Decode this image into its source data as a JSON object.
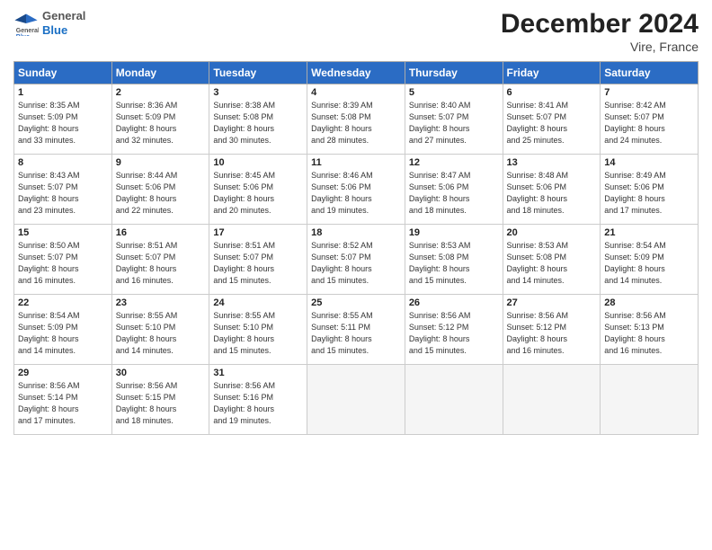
{
  "header": {
    "logo_general": "General",
    "logo_blue": "Blue",
    "month_title": "December 2024",
    "location": "Vire, France"
  },
  "weekdays": [
    "Sunday",
    "Monday",
    "Tuesday",
    "Wednesday",
    "Thursday",
    "Friday",
    "Saturday"
  ],
  "weeks": [
    [
      {
        "day": "1",
        "info": "Sunrise: 8:35 AM\nSunset: 5:09 PM\nDaylight: 8 hours\nand 33 minutes."
      },
      {
        "day": "2",
        "info": "Sunrise: 8:36 AM\nSunset: 5:09 PM\nDaylight: 8 hours\nand 32 minutes."
      },
      {
        "day": "3",
        "info": "Sunrise: 8:38 AM\nSunset: 5:08 PM\nDaylight: 8 hours\nand 30 minutes."
      },
      {
        "day": "4",
        "info": "Sunrise: 8:39 AM\nSunset: 5:08 PM\nDaylight: 8 hours\nand 28 minutes."
      },
      {
        "day": "5",
        "info": "Sunrise: 8:40 AM\nSunset: 5:07 PM\nDaylight: 8 hours\nand 27 minutes."
      },
      {
        "day": "6",
        "info": "Sunrise: 8:41 AM\nSunset: 5:07 PM\nDaylight: 8 hours\nand 25 minutes."
      },
      {
        "day": "7",
        "info": "Sunrise: 8:42 AM\nSunset: 5:07 PM\nDaylight: 8 hours\nand 24 minutes."
      }
    ],
    [
      {
        "day": "8",
        "info": "Sunrise: 8:43 AM\nSunset: 5:07 PM\nDaylight: 8 hours\nand 23 minutes."
      },
      {
        "day": "9",
        "info": "Sunrise: 8:44 AM\nSunset: 5:06 PM\nDaylight: 8 hours\nand 22 minutes."
      },
      {
        "day": "10",
        "info": "Sunrise: 8:45 AM\nSunset: 5:06 PM\nDaylight: 8 hours\nand 20 minutes."
      },
      {
        "day": "11",
        "info": "Sunrise: 8:46 AM\nSunset: 5:06 PM\nDaylight: 8 hours\nand 19 minutes."
      },
      {
        "day": "12",
        "info": "Sunrise: 8:47 AM\nSunset: 5:06 PM\nDaylight: 8 hours\nand 18 minutes."
      },
      {
        "day": "13",
        "info": "Sunrise: 8:48 AM\nSunset: 5:06 PM\nDaylight: 8 hours\nand 18 minutes."
      },
      {
        "day": "14",
        "info": "Sunrise: 8:49 AM\nSunset: 5:06 PM\nDaylight: 8 hours\nand 17 minutes."
      }
    ],
    [
      {
        "day": "15",
        "info": "Sunrise: 8:50 AM\nSunset: 5:07 PM\nDaylight: 8 hours\nand 16 minutes."
      },
      {
        "day": "16",
        "info": "Sunrise: 8:51 AM\nSunset: 5:07 PM\nDaylight: 8 hours\nand 16 minutes."
      },
      {
        "day": "17",
        "info": "Sunrise: 8:51 AM\nSunset: 5:07 PM\nDaylight: 8 hours\nand 15 minutes."
      },
      {
        "day": "18",
        "info": "Sunrise: 8:52 AM\nSunset: 5:07 PM\nDaylight: 8 hours\nand 15 minutes."
      },
      {
        "day": "19",
        "info": "Sunrise: 8:53 AM\nSunset: 5:08 PM\nDaylight: 8 hours\nand 15 minutes."
      },
      {
        "day": "20",
        "info": "Sunrise: 8:53 AM\nSunset: 5:08 PM\nDaylight: 8 hours\nand 14 minutes."
      },
      {
        "day": "21",
        "info": "Sunrise: 8:54 AM\nSunset: 5:09 PM\nDaylight: 8 hours\nand 14 minutes."
      }
    ],
    [
      {
        "day": "22",
        "info": "Sunrise: 8:54 AM\nSunset: 5:09 PM\nDaylight: 8 hours\nand 14 minutes."
      },
      {
        "day": "23",
        "info": "Sunrise: 8:55 AM\nSunset: 5:10 PM\nDaylight: 8 hours\nand 14 minutes."
      },
      {
        "day": "24",
        "info": "Sunrise: 8:55 AM\nSunset: 5:10 PM\nDaylight: 8 hours\nand 15 minutes."
      },
      {
        "day": "25",
        "info": "Sunrise: 8:55 AM\nSunset: 5:11 PM\nDaylight: 8 hours\nand 15 minutes."
      },
      {
        "day": "26",
        "info": "Sunrise: 8:56 AM\nSunset: 5:12 PM\nDaylight: 8 hours\nand 15 minutes."
      },
      {
        "day": "27",
        "info": "Sunrise: 8:56 AM\nSunset: 5:12 PM\nDaylight: 8 hours\nand 16 minutes."
      },
      {
        "day": "28",
        "info": "Sunrise: 8:56 AM\nSunset: 5:13 PM\nDaylight: 8 hours\nand 16 minutes."
      }
    ],
    [
      {
        "day": "29",
        "info": "Sunrise: 8:56 AM\nSunset: 5:14 PM\nDaylight: 8 hours\nand 17 minutes."
      },
      {
        "day": "30",
        "info": "Sunrise: 8:56 AM\nSunset: 5:15 PM\nDaylight: 8 hours\nand 18 minutes."
      },
      {
        "day": "31",
        "info": "Sunrise: 8:56 AM\nSunset: 5:16 PM\nDaylight: 8 hours\nand 19 minutes."
      },
      null,
      null,
      null,
      null
    ]
  ]
}
